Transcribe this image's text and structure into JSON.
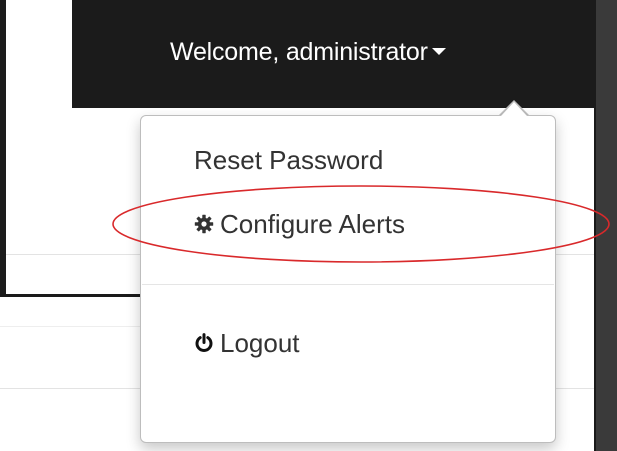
{
  "navbar": {
    "user_label": "Welcome, administrator"
  },
  "dropdown": {
    "items": [
      {
        "label": "Reset Password",
        "icon": ""
      },
      {
        "label": "Configure Alerts",
        "icon": "gear-icon"
      },
      {
        "label": "Logout",
        "icon": "power-icon"
      }
    ]
  },
  "colors": {
    "navbar_bg": "#1b1b1b",
    "menu_text": "#333333",
    "highlight": "#d9292b"
  }
}
